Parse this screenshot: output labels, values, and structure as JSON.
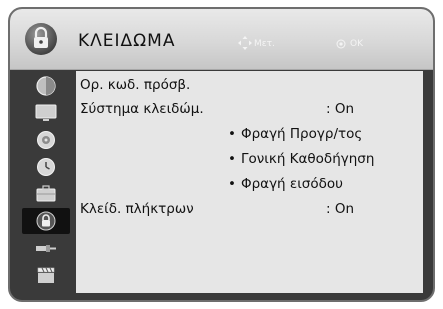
{
  "header": {
    "title": "ΚΛΕΙΔΩΜΑ",
    "hint_move": "Μετ.",
    "hint_ok": "OK",
    "menu_icon": "padlock-icon"
  },
  "sidebar": {
    "items": [
      {
        "icon": "picture-icon",
        "active": false
      },
      {
        "icon": "tv-screen-icon",
        "active": false
      },
      {
        "icon": "audio-icon",
        "active": false
      },
      {
        "icon": "clock-icon",
        "active": false
      },
      {
        "icon": "options-icon",
        "active": false
      },
      {
        "icon": "lock-icon",
        "active": true
      },
      {
        "icon": "input-cable-icon",
        "active": false
      },
      {
        "icon": "clapperboard-icon",
        "active": false
      }
    ]
  },
  "menu": {
    "set_password": {
      "label": "Ορ. κωδ. πρόσβ."
    },
    "lock_system": {
      "label": "Σύστημα κλειδώμ.",
      "value": ": On"
    },
    "sub_items": [
      {
        "bullet": "•",
        "label": "Φραγή Προγρ/τος"
      },
      {
        "bullet": "•",
        "label": "Γονική Καθοδήγηση"
      },
      {
        "bullet": "•",
        "label": "Φραγή εισόδου"
      }
    ],
    "key_lock": {
      "label": "Κλείδ. πλήκτρων",
      "value": ": On"
    }
  },
  "colors": {
    "frame": "#3a3a3a",
    "header_light": "#e9e9e9",
    "content_bg": "#e6e6e6",
    "active_item": "#111111"
  }
}
